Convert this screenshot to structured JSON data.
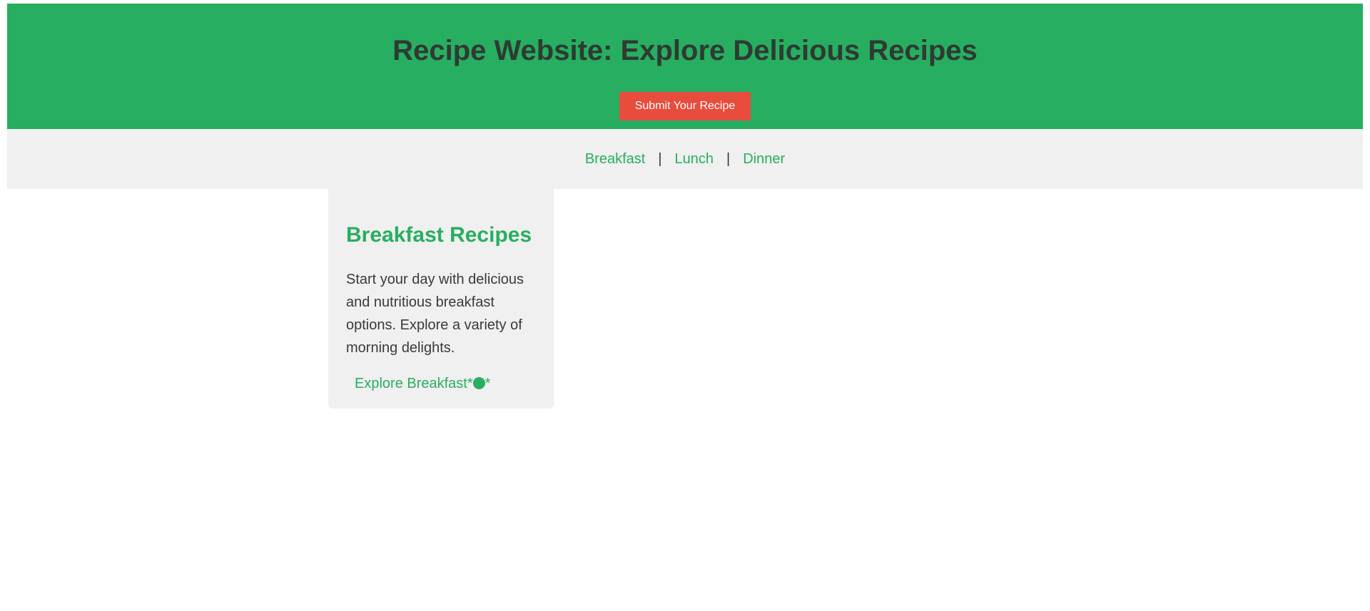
{
  "header": {
    "title": "Recipe Website: Explore Delicious Recipes",
    "submit_label": "Submit Your Recipe"
  },
  "nav": {
    "items": [
      {
        "label": "Breakfast"
      },
      {
        "label": "Lunch"
      },
      {
        "label": "Dinner"
      }
    ],
    "separator": "|"
  },
  "card": {
    "title": "Breakfast Recipes",
    "description": "Start your day with delicious and nutritious breakfast options. Explore a variety of morning delights.",
    "link_label": "Explore Breakfast*",
    "link_suffix": "*",
    "link_icon": "green-dot-icon"
  },
  "colors": {
    "brand_green": "#27ae60",
    "button_red": "#e74c3c",
    "nav_background": "#f0f0f0"
  }
}
